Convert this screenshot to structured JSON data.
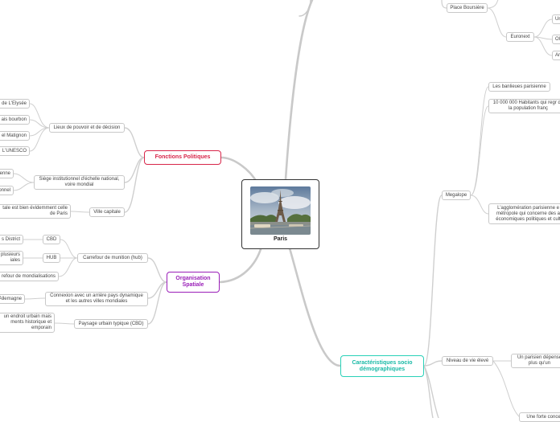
{
  "root": {
    "title": "Paris",
    "image": "eiffel-tower-photo"
  },
  "branches": {
    "fonctions_politiques": {
      "label": "Fonctions Politiques",
      "color": "#d8264a",
      "lieux": {
        "label": "Lieux de pouvoir et de décision",
        "items": [
          "de L'Elysée",
          "ais bourbon",
          "el Matignon",
          "L'UNESCO"
        ]
      },
      "siege": {
        "label": "Siège institutionnel d'échelle national, voire mondial",
        "items": [
          "enne",
          "onnel"
        ]
      },
      "capitale": {
        "label": "Ville capitale",
        "items": [
          "tale est bien évidemment celle de Paris"
        ]
      }
    },
    "organisation_spatiale": {
      "label": "Organisation Spatiale",
      "color": "#9a1fb8",
      "carrefour": {
        "label": "Carrefour de munition (hub)",
        "children": [
          {
            "label": "CBD",
            "item": "s District"
          },
          {
            "label": "HUB",
            "item": "plusieurs iales"
          }
        ],
        "extra": "refour de mondialisations"
      },
      "connexion": {
        "label": "Connexion avec un arrière pays dynamique et les autres villes mondiales",
        "items": [
          "Allemagne"
        ]
      },
      "paysage": {
        "label": "Paysage urbain typique (CBD)",
        "items": [
          "un endroit urbain mais ments historique et emporain"
        ]
      }
    },
    "caracteristiques": {
      "label": "Caractéristiques socio démographiques",
      "color": "#2ad1b8",
      "megalope": {
        "label": "Megalope",
        "items": [
          "Les banlieues parisienne",
          "10 000 000 Habitants qui regr de la population franç",
          "L'agglomération parisienne e métropole qui concerne des a économiques politiques et cult"
        ]
      },
      "niveau": {
        "label": "Niveau de vie élevé",
        "items": [
          "Un parisien dépense plus qu'un"
        ]
      },
      "bottom_partial": "Une forte conce"
    },
    "economie": {
      "place_boursiere": "Place Boursière",
      "euronext": "Euronext",
      "euronext_children": [
        "Ur",
        "Ol",
        "Ar"
      ]
    }
  }
}
